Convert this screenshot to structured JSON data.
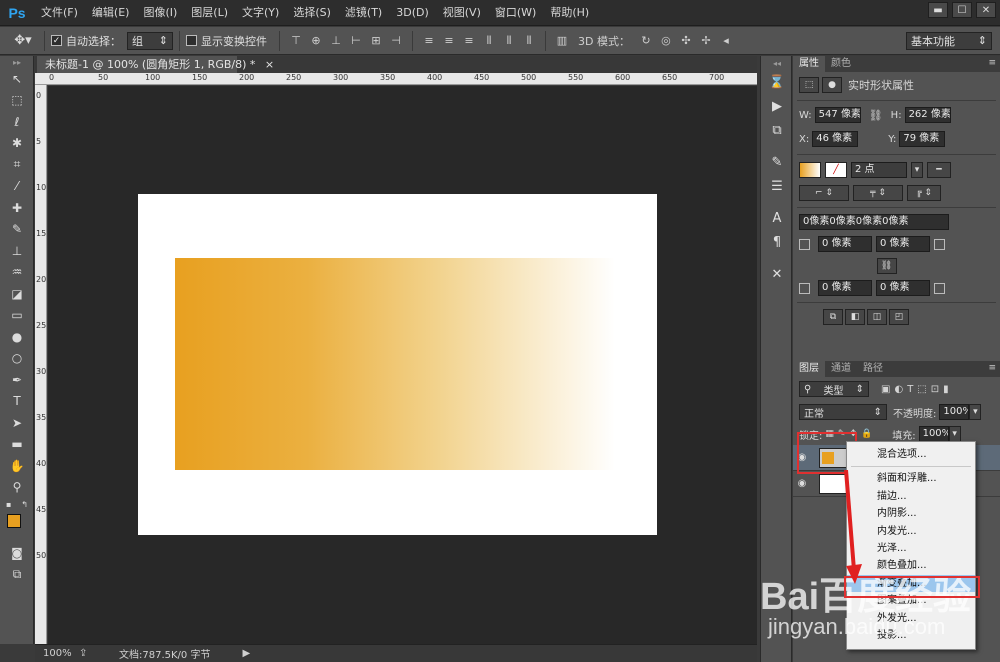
{
  "app": {
    "logo": "Ps"
  },
  "menu": [
    "文件(F)",
    "编辑(E)",
    "图像(I)",
    "图层(L)",
    "文字(Y)",
    "选择(S)",
    "滤镜(T)",
    "3D(D)",
    "视图(V)",
    "窗口(W)",
    "帮助(H)"
  ],
  "window_controls": {
    "minimize": "▬",
    "maximize": "☐",
    "close": "✕"
  },
  "options": {
    "auto_select_label": "自动选择：",
    "auto_select_checked": true,
    "auto_select_value": "组",
    "show_transform_label": "显示变换控件",
    "show_transform_checked": false,
    "mode_3d_label": "3D 模式：",
    "workspace": "基本功能"
  },
  "document": {
    "tab_title": "未标题-1 @ 100% (圆角矩形 1, RGB/8) *",
    "tab_close": "×",
    "ruler_top_ticks": [
      "0",
      "50",
      "100",
      "150",
      "200",
      "250",
      "300",
      "350",
      "400",
      "450",
      "500",
      "550",
      "600",
      "650",
      "700"
    ],
    "ruler_left_ticks": [
      "0",
      "5",
      "10",
      "15",
      "20",
      "25",
      "30",
      "35",
      "40",
      "45",
      "50"
    ],
    "zoom": "100%",
    "doc_info": "文档:787.5K/0 字节"
  },
  "colors": {
    "foreground": "#e8a020",
    "background": "#ffffff"
  },
  "properties": {
    "tabs": [
      "属性",
      "颜色"
    ],
    "title": "实时形状属性",
    "w_label": "W:",
    "w_value": "547 像素",
    "h_label": "H:",
    "h_value": "262 像素",
    "x_label": "X:",
    "x_value": "46 像素",
    "y_label": "Y:",
    "y_value": "79 像素",
    "stroke_width": "2 点",
    "corner_text": "0像素0像素0像素0像素",
    "corner_tl": "0 像素",
    "corner_tr": "0 像素",
    "corner_bl": "0 像素",
    "corner_br": "0 像素"
  },
  "layers_panel": {
    "tabs": [
      "图层",
      "通道",
      "路径"
    ],
    "filter_kind": "类型",
    "blend_mode": "正常",
    "opacity_label": "不透明度:",
    "opacity_value": "100%",
    "lock_label": "锁定:",
    "fill_label": "填充:",
    "fill_value": "100%"
  },
  "context_menu": {
    "items": [
      "混合选项...",
      "斜面和浮雕...",
      "描边...",
      "内阴影...",
      "内发光...",
      "光泽...",
      "颜色叠加...",
      "渐变叠加...",
      "图案叠加...",
      "外发光...",
      "投影..."
    ],
    "selected_index": 7
  },
  "watermark": {
    "line1": "Bai百度经验",
    "line2": "jingyan.baidu.com"
  }
}
